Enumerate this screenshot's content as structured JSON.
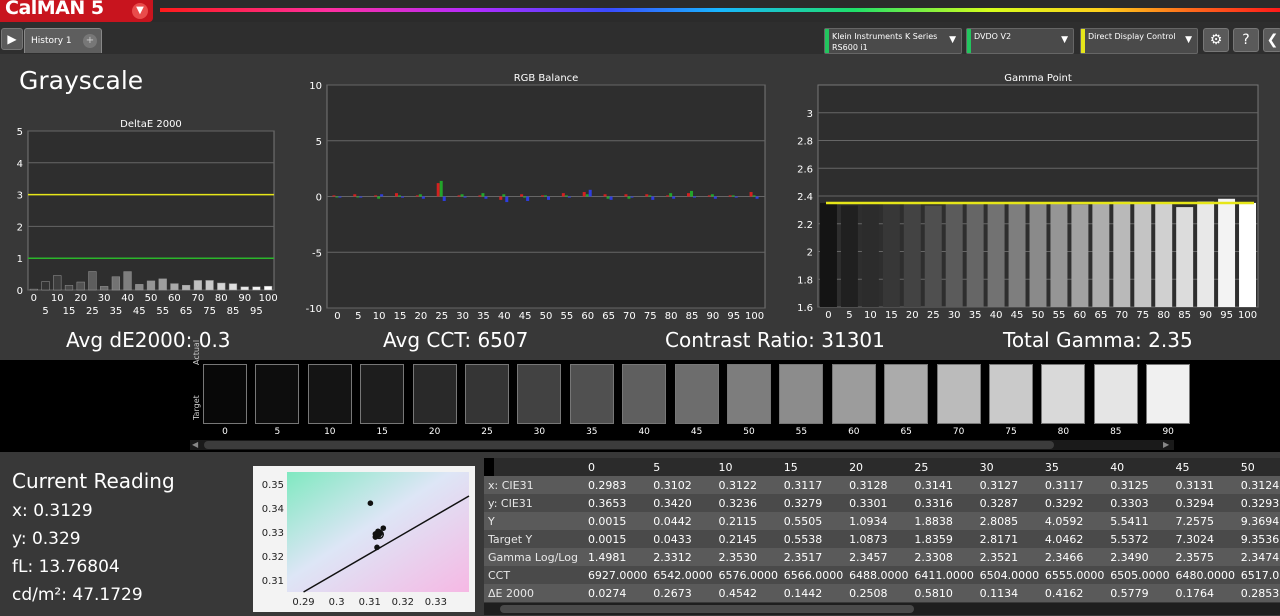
{
  "app": {
    "logo_text": "CalMAN 5"
  },
  "toolbar": {
    "history_tab": "History 1",
    "devices": [
      {
        "label_line1": "Klein Instruments K Series",
        "label_line2": "RS600 i1",
        "accent": "#22c55e"
      },
      {
        "label_line1": "DVDO V2",
        "label_line2": "",
        "accent": "#22c55e"
      },
      {
        "label_line1": "Direct Display Control",
        "label_line2": "",
        "accent": "#e5e51a"
      }
    ]
  },
  "page": {
    "title": "Grayscale"
  },
  "summary": {
    "avg_de": "Avg dE2000: 0.3",
    "avg_cct": "Avg CCT: 6507",
    "contrast": "Contrast Ratio: 31301",
    "total_gamma": "Total Gamma: 2.35"
  },
  "chart_data": [
    {
      "type": "bar",
      "title": "DeltaE 2000",
      "categories": [
        "0",
        "5",
        "10",
        "15",
        "20",
        "25",
        "30",
        "35",
        "40",
        "45",
        "50",
        "55",
        "60",
        "65",
        "70",
        "75",
        "80",
        "85",
        "90",
        "95",
        "100"
      ],
      "values": [
        0.0274,
        0.2673,
        0.4542,
        0.1442,
        0.2508,
        0.581,
        0.1134,
        0.4162,
        0.5779,
        0.1764,
        0.2853,
        0.35,
        0.2,
        0.15,
        0.3,
        0.3,
        0.22,
        0.2,
        0.1,
        0.1,
        0.12
      ],
      "ylim": [
        0,
        5
      ],
      "yticks": [
        0,
        1,
        2,
        3,
        4,
        5
      ],
      "reference_lines": [
        {
          "y": 3,
          "color": "#e6e619"
        },
        {
          "y": 1,
          "color": "#2bb52b"
        }
      ]
    },
    {
      "type": "bar",
      "title": "RGB Balance",
      "categories": [
        "0",
        "5",
        "10",
        "15",
        "20",
        "25",
        "30",
        "35",
        "40",
        "45",
        "50",
        "55",
        "60",
        "65",
        "70",
        "75",
        "80",
        "85",
        "90",
        "95",
        "100"
      ],
      "series": [
        {
          "name": "R",
          "color": "#d42020",
          "values": [
            0.1,
            0.2,
            0.1,
            0.3,
            0.1,
            1.2,
            0.1,
            0.1,
            -0.3,
            0.2,
            0.1,
            0.3,
            0.4,
            0.2,
            0.2,
            0.2,
            0.1,
            0.3,
            0.1,
            0.1,
            0.4
          ]
        },
        {
          "name": "G",
          "color": "#22a52a",
          "values": [
            0.0,
            0.0,
            -0.2,
            0.1,
            0.2,
            1.4,
            0.2,
            0.3,
            0.2,
            -0.1,
            0.1,
            0.1,
            0.2,
            -0.2,
            -0.2,
            0.1,
            0.3,
            0.5,
            0.2,
            0.1,
            0.1
          ]
        },
        {
          "name": "B",
          "color": "#2d3de0",
          "values": [
            -0.1,
            -0.1,
            0.2,
            -0.1,
            -0.2,
            -0.4,
            -0.1,
            -0.2,
            -0.5,
            -0.4,
            -0.3,
            -0.1,
            0.6,
            -0.3,
            -0.1,
            -0.3,
            -0.2,
            -0.1,
            -0.2,
            -0.1,
            -0.2
          ]
        }
      ],
      "ylim": [
        -10,
        10
      ],
      "yticks": [
        -10,
        -5,
        0,
        5,
        10
      ]
    },
    {
      "type": "bar",
      "title": "Gamma Point",
      "categories": [
        "0",
        "5",
        "10",
        "15",
        "20",
        "25",
        "30",
        "35",
        "40",
        "45",
        "50",
        "55",
        "60",
        "65",
        "70",
        "75",
        "80",
        "85",
        "90",
        "95",
        "100"
      ],
      "values": [
        2.35,
        2.3312,
        2.353,
        2.3517,
        2.3457,
        2.3308,
        2.3521,
        2.3466,
        2.349,
        2.3575,
        2.3474,
        2.35,
        2.34,
        2.35,
        2.36,
        2.35,
        2.35,
        2.32,
        2.36,
        2.38,
        2.35
      ],
      "target": 2.35,
      "ylim": [
        1.6,
        3.2
      ],
      "yticks": [
        1.6,
        1.8,
        2,
        2.2,
        2.4,
        2.6,
        2.8,
        3
      ]
    },
    {
      "type": "scatter",
      "title": "",
      "x": [
        0.3102,
        0.3122,
        0.3117,
        0.3128,
        0.3141,
        0.3127,
        0.3117,
        0.3125,
        0.3131,
        0.3124
      ],
      "y": [
        0.342,
        0.3236,
        0.3279,
        0.3301,
        0.3316,
        0.3287,
        0.3292,
        0.3303,
        0.3294,
        0.3293
      ],
      "xlim": [
        0.285,
        0.34
      ],
      "ylim": [
        0.305,
        0.355
      ],
      "xticks": [
        "0.29",
        "0.3",
        "0.31",
        "0.32",
        "0.33"
      ],
      "yticks": [
        "0.31",
        "0.32",
        "0.33",
        "0.34",
        "0.35"
      ]
    }
  ],
  "swatches": {
    "actual_label": "Actual",
    "target_label": "Target",
    "levels": [
      "0",
      "5",
      "10",
      "15",
      "20",
      "25",
      "30",
      "35",
      "40",
      "45",
      "50",
      "55",
      "60",
      "65",
      "70",
      "75",
      "80",
      "85",
      "90"
    ],
    "colors": [
      "#080808",
      "#0d0d0d",
      "#141414",
      "#1d1d1d",
      "#292929",
      "#353535",
      "#424242",
      "#505050",
      "#5f5f5f",
      "#6d6d6d",
      "#7d7d7d",
      "#8c8c8c",
      "#9c9c9c",
      "#ababab",
      "#bbbbbb",
      "#cacaca",
      "#d9d9d9",
      "#e5e5e5",
      "#f0f0f0"
    ]
  },
  "current_reading": {
    "title": "Current Reading",
    "x": "x: 0.3129",
    "y": "y: 0.329",
    "fl": "fL: 13.76804",
    "cdm2": "cd/m²: 47.1729"
  },
  "table": {
    "headers": [
      "",
      "0",
      "5",
      "10",
      "15",
      "20",
      "25",
      "30",
      "35",
      "40",
      "45",
      "50"
    ],
    "rows": [
      [
        "x: CIE31",
        "0.2983",
        "0.3102",
        "0.3122",
        "0.3117",
        "0.3128",
        "0.3141",
        "0.3127",
        "0.3117",
        "0.3125",
        "0.3131",
        "0.3124"
      ],
      [
        "y: CIE31",
        "0.3653",
        "0.3420",
        "0.3236",
        "0.3279",
        "0.3301",
        "0.3316",
        "0.3287",
        "0.3292",
        "0.3303",
        "0.3294",
        "0.3293"
      ],
      [
        "Y",
        "0.0015",
        "0.0442",
        "0.2115",
        "0.5505",
        "1.0934",
        "1.8838",
        "2.8085",
        "4.0592",
        "5.5411",
        "7.2575",
        "9.3694"
      ],
      [
        "Target Y",
        "0.0015",
        "0.0433",
        "0.2145",
        "0.5538",
        "1.0873",
        "1.8359",
        "2.8171",
        "4.0462",
        "5.5372",
        "7.3024",
        "9.3536"
      ],
      [
        "Gamma Log/Log",
        "1.4981",
        "2.3312",
        "2.3530",
        "2.3517",
        "2.3457",
        "2.3308",
        "2.3521",
        "2.3466",
        "2.3490",
        "2.3575",
        "2.3474"
      ],
      [
        "CCT",
        "6927.0000",
        "6542.0000",
        "6576.0000",
        "6566.0000",
        "6488.0000",
        "6411.0000",
        "6504.0000",
        "6555.0000",
        "6505.0000",
        "6480.0000",
        "6517.0"
      ],
      [
        "ΔE 2000",
        "0.0274",
        "0.2673",
        "0.4542",
        "0.1442",
        "0.2508",
        "0.5810",
        "0.1134",
        "0.4162",
        "0.5779",
        "0.1764",
        "0.2853"
      ]
    ]
  }
}
